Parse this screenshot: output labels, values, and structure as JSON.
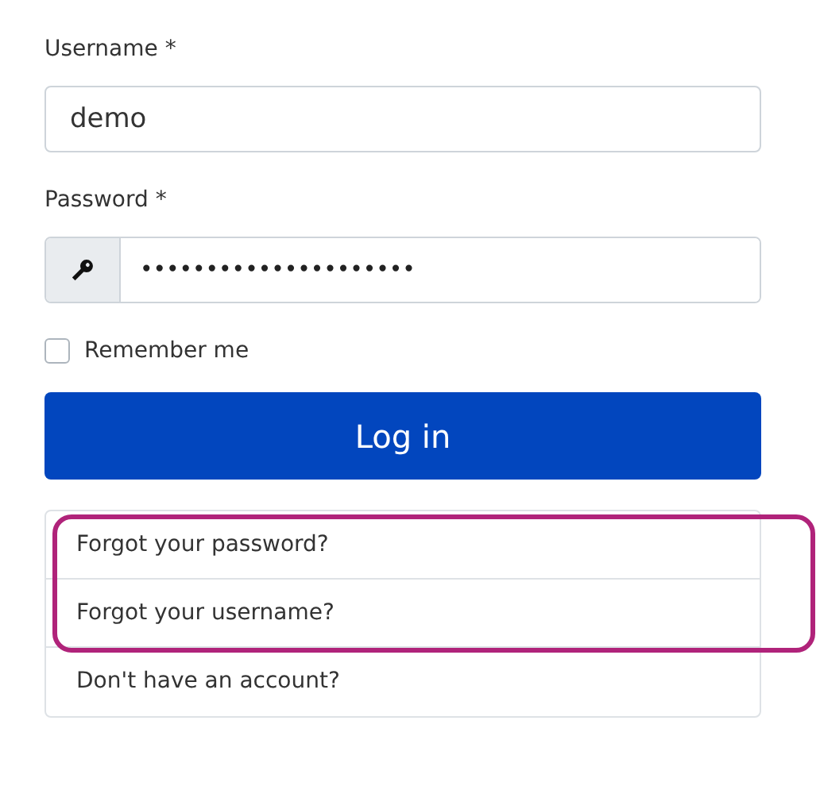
{
  "username": {
    "label": "Username *",
    "value": "demo"
  },
  "password": {
    "label": "Password *",
    "value": "•••••••••••••••••••••"
  },
  "remember": {
    "label": "Remember me",
    "checked": false
  },
  "login_button": "Log in",
  "links": [
    {
      "label": "Forgot your password?",
      "highlighted": true
    },
    {
      "label": "Forgot your username?",
      "highlighted": true
    },
    {
      "label": "Don't have an account?",
      "highlighted": false
    }
  ]
}
